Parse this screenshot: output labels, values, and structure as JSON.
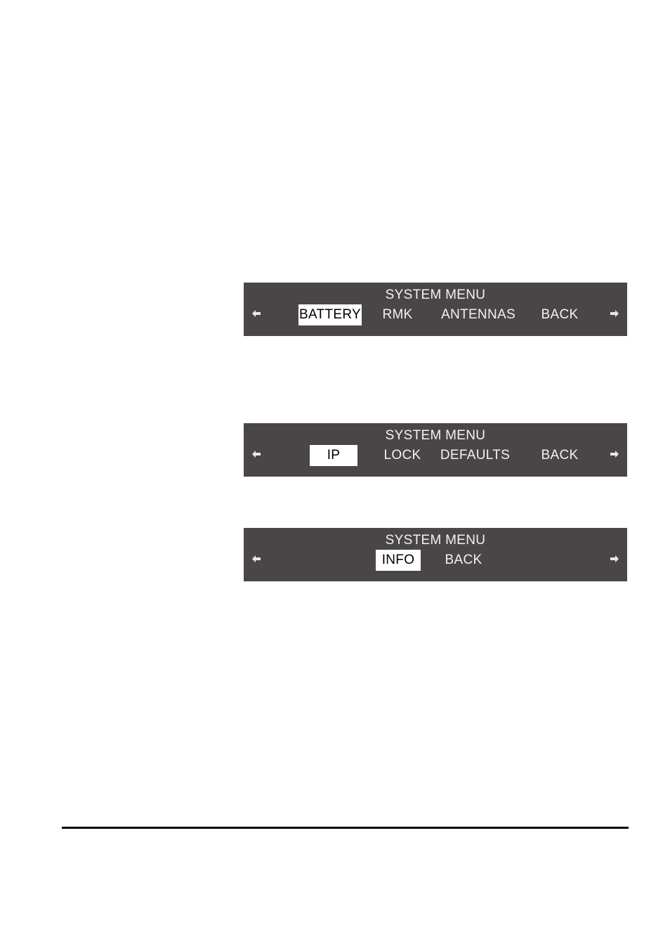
{
  "page": {
    "background_color": "#ffffff",
    "panel_background_color": "#4a4647",
    "panel_text_color": "#f2f2f2",
    "selected_background_color": "#ffffff",
    "selected_text_color": "#000000",
    "footer_rule_color": "#000000"
  },
  "panels": [
    {
      "title": "SYSTEM MENU",
      "left_arrow": "arrow-left-icon",
      "right_arrow": "arrow-right-icon",
      "items": [
        {
          "label": "BATTERY",
          "selected": true
        },
        {
          "label": "RMK",
          "selected": false
        },
        {
          "label": "ANTENNAS",
          "selected": false
        },
        {
          "label": "BACK",
          "selected": false
        }
      ]
    },
    {
      "title": "SYSTEM MENU",
      "left_arrow": "arrow-left-icon",
      "right_arrow": "arrow-right-icon",
      "items": [
        {
          "label": "IP",
          "selected": true
        },
        {
          "label": "LOCK",
          "selected": false
        },
        {
          "label": "DEFAULTS",
          "selected": false
        },
        {
          "label": "BACK",
          "selected": false
        }
      ]
    },
    {
      "title": "SYSTEM MENU",
      "left_arrow": "arrow-left-icon",
      "right_arrow": "arrow-right-icon",
      "items": [
        {
          "label": "INFO",
          "selected": true
        },
        {
          "label": "BACK",
          "selected": false
        }
      ]
    }
  ]
}
